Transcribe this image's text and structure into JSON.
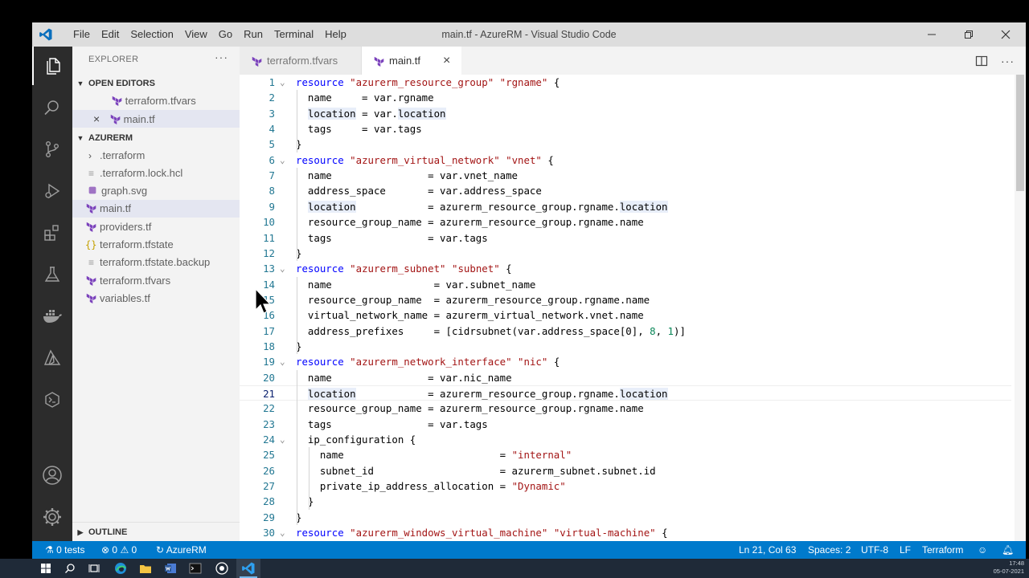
{
  "window": {
    "title": "main.tf - AzureRM - Visual Studio Code",
    "menu": [
      "File",
      "Edit",
      "Selection",
      "View",
      "Go",
      "Run",
      "Terminal",
      "Help"
    ]
  },
  "sidebar": {
    "header": "EXPLORER",
    "more": "···",
    "open_editors_title": "OPEN EDITORS",
    "open_editors": [
      {
        "label": "terraform.tfvars",
        "close": ""
      },
      {
        "label": "main.tf",
        "close": "×"
      }
    ],
    "folder_title": "AZURERM",
    "files": [
      {
        "label": ".terraform",
        "kind": "folder"
      },
      {
        "label": ".terraform.lock.hcl",
        "kind": "lines"
      },
      {
        "label": "graph.svg",
        "kind": "svg"
      },
      {
        "label": "main.tf",
        "kind": "tf"
      },
      {
        "label": "providers.tf",
        "kind": "tf"
      },
      {
        "label": "terraform.tfstate",
        "kind": "json"
      },
      {
        "label": "terraform.tfstate.backup",
        "kind": "lines"
      },
      {
        "label": "terraform.tfvars",
        "kind": "tf"
      },
      {
        "label": "variables.tf",
        "kind": "tf"
      }
    ],
    "outline_title": "OUTLINE"
  },
  "tabs": [
    {
      "label": "terraform.tfvars",
      "active": false
    },
    {
      "label": "main.tf",
      "active": true,
      "close": "×"
    }
  ],
  "editor": {
    "current_line": 21,
    "lines": [
      {
        "n": "1",
        "fold": "⌄",
        "code": "<span class='kw'>resource</span> <span class='st'>\"azurerm_resource_group\"</span> <span class='st'>\"rgname\"</span> {"
      },
      {
        "n": "2",
        "fold": "",
        "code": "  name     = var.rgname"
      },
      {
        "n": "3",
        "fold": "",
        "code": "  <span class='hl'>location</span> = var.<span class='hl'>location</span>"
      },
      {
        "n": "4",
        "fold": "",
        "code": "  tags     = var.tags"
      },
      {
        "n": "5",
        "fold": "",
        "code": "}"
      },
      {
        "n": "6",
        "fold": "⌄",
        "code": "<span class='kw'>resource</span> <span class='st'>\"azurerm_virtual_network\"</span> <span class='st'>\"vnet\"</span> {"
      },
      {
        "n": "7",
        "fold": "",
        "code": "  name                = var.vnet_name"
      },
      {
        "n": "8",
        "fold": "",
        "code": "  address_space       = var.address_space"
      },
      {
        "n": "9",
        "fold": "",
        "code": "  <span class='hl'>location</span>            = azurerm_resource_group.rgname.<span class='hl'>location</span>"
      },
      {
        "n": "10",
        "fold": "",
        "code": "  resource_group_name = azurerm_resource_group.rgname.name"
      },
      {
        "n": "11",
        "fold": "",
        "code": "  tags                = var.tags"
      },
      {
        "n": "12",
        "fold": "",
        "code": "}"
      },
      {
        "n": "13",
        "fold": "⌄",
        "code": "<span class='kw'>resource</span> <span class='st'>\"azurerm_subnet\"</span> <span class='st'>\"subnet\"</span> {"
      },
      {
        "n": "14",
        "fold": "",
        "code": "  name                 = var.subnet_name"
      },
      {
        "n": "15",
        "fold": "",
        "code": "  resource_group_name  = azurerm_resource_group.rgname.name"
      },
      {
        "n": "16",
        "fold": "",
        "code": "  virtual_network_name = azurerm_virtual_network.vnet.name"
      },
      {
        "n": "17",
        "fold": "",
        "code": "  address_prefixes     = [cidrsubnet(var.address_space[0], <span class='nm'>8</span>, <span class='nm'>1</span>)]"
      },
      {
        "n": "18",
        "fold": "",
        "code": "}"
      },
      {
        "n": "19",
        "fold": "⌄",
        "code": "<span class='kw'>resource</span> <span class='st'>\"azurerm_network_interface\"</span> <span class='st'>\"nic\"</span> {"
      },
      {
        "n": "20",
        "fold": "",
        "code": "  name                = var.nic_name"
      },
      {
        "n": "21",
        "fold": "",
        "code": "  <span class='hl'>location</span>            = azurerm_resource_group.rgname.<span class='hl'>location</span>"
      },
      {
        "n": "22",
        "fold": "",
        "code": "  resource_group_name = azurerm_resource_group.rgname.name"
      },
      {
        "n": "23",
        "fold": "",
        "code": "  tags                = var.tags"
      },
      {
        "n": "24",
        "fold": "⌄",
        "code": "  ip_configuration {"
      },
      {
        "n": "25",
        "fold": "",
        "code": "    name                          = <span class='st'>\"internal\"</span>"
      },
      {
        "n": "26",
        "fold": "",
        "code": "    subnet_id                     = azurerm_subnet.subnet.id"
      },
      {
        "n": "27",
        "fold": "",
        "code": "    private_ip_address_allocation = <span class='st'>\"Dynamic\"</span>"
      },
      {
        "n": "28",
        "fold": "",
        "code": "  }"
      },
      {
        "n": "29",
        "fold": "",
        "code": "}"
      },
      {
        "n": "30",
        "fold": "⌄",
        "code": "<span class='kw'>resource</span> <span class='st'>\"azurerm_windows_virtual_machine\"</span> <span class='st'>\"virtual-machine\"</span> {"
      }
    ]
  },
  "status": {
    "tests": "0 tests",
    "errors": "0",
    "warnings": "0",
    "workspace": "AzureRM",
    "position": "Ln 21, Col 63",
    "spaces": "Spaces: 2",
    "encoding": "UTF-8",
    "eol": "LF",
    "language": "Terraform"
  },
  "taskbar": {
    "time": "17:48",
    "date": "05-07-2021"
  },
  "colors": {
    "accent": "#007acc",
    "terraform_icon": "#7b42bc",
    "keyword": "#0000ff",
    "string": "#a31515"
  }
}
